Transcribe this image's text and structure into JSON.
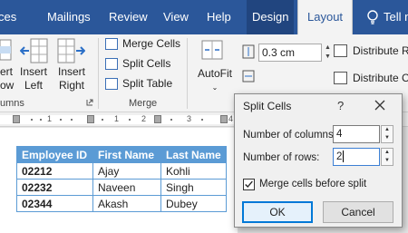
{
  "tabs": [
    {
      "label": "Mailings"
    },
    {
      "label": "Review"
    },
    {
      "label": "View"
    },
    {
      "label": "Help"
    },
    {
      "label": "Design"
    },
    {
      "label": "Layout",
      "active": true
    }
  ],
  "partial_tab_left": "ces",
  "tell_me": "Tell m",
  "ribbon": {
    "insert_left_partial": [
      "ert",
      "ow"
    ],
    "insert_left": [
      "Insert",
      "Left"
    ],
    "insert_right": [
      "Insert",
      "Right"
    ],
    "merge_cells": "Merge Cells",
    "split_cells": "Split Cells",
    "split_table": "Split Table",
    "autofit": "AutoFit",
    "row_height": "0.3 cm",
    "distribute_rows": "Distribute Ro",
    "distribute_cols": "Distribute Co",
    "group_rows_cols": "umns",
    "group_merge": "Merge"
  },
  "ruler": {
    "numbers": [
      "1",
      "1",
      "2",
      "3",
      "4"
    ]
  },
  "table": {
    "headers": [
      "Employee ID",
      "First Name",
      "Last Name"
    ],
    "rows": [
      [
        "02212",
        "Ajay",
        "Kohli"
      ],
      [
        "02232",
        "Naveen",
        "Singh"
      ],
      [
        "02344",
        "Akash",
        "Dubey"
      ]
    ]
  },
  "dialog": {
    "title": "Split Cells",
    "help": "?",
    "columns_label": "Number of columns:",
    "columns_value": "4",
    "rows_label": "Number of rows:",
    "rows_value": "2",
    "merge_label": "Merge cells before split",
    "merge_checked": true,
    "ok": "OK",
    "cancel": "Cancel"
  },
  "colors": {
    "accent": "#2b579a",
    "table_header": "#5b9bd5"
  }
}
